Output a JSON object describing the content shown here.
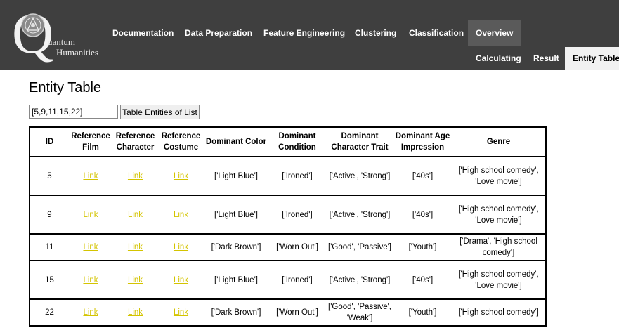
{
  "logo": {
    "letter": "Q",
    "line1": "uantum",
    "line2": "Humanities"
  },
  "nav": {
    "documentation": "Documentation",
    "data_preparation": "Data Preparation",
    "feature_engineering": "Feature Engineering",
    "clustering": "Clustering",
    "classification": "Classification",
    "overview": "Overview"
  },
  "subnav": {
    "calculating": "Calculating",
    "result": "Result",
    "entity_table": "Entity Table"
  },
  "page": {
    "title": "Entity Table",
    "input_value": "[5,9,11,15,22]",
    "button_label": "Table Entities of List"
  },
  "colors": {
    "topbar": "#3f3f3f",
    "link": "#d4c400",
    "active_nav": "#5a5a5a",
    "active_subnav": "#f1f1f1"
  },
  "table": {
    "headers": [
      "ID",
      "Reference Film",
      "Reference Character",
      "Reference Costume",
      "Dominant Color",
      "Dominant Condition",
      "Dominant Character Trait",
      "Dominant Age Impression",
      "Genre"
    ],
    "link_text": "Link",
    "rows": [
      {
        "id": "5",
        "color": "['Light Blue']",
        "condition": "['Ironed']",
        "trait": "['Active', 'Strong']",
        "age": "['40s']",
        "genre": "['High school comedy', 'Love movie']"
      },
      {
        "id": "9",
        "color": "['Light Blue']",
        "condition": "['Ironed']",
        "trait": "['Active', 'Strong']",
        "age": "['40s']",
        "genre": "['High school comedy', 'Love movie']"
      },
      {
        "id": "11",
        "color": "['Dark Brown']",
        "condition": "['Worn Out']",
        "trait": "['Good', 'Passive']",
        "age": "['Youth']",
        "genre": "['Drama', 'High school comedy']"
      },
      {
        "id": "15",
        "color": "['Light Blue']",
        "condition": "['Ironed']",
        "trait": "['Active', 'Strong']",
        "age": "['40s']",
        "genre": "['High school comedy', 'Love movie']"
      },
      {
        "id": "22",
        "color": "['Dark Brown']",
        "condition": "['Worn Out']",
        "trait": "['Good', 'Passive', 'Weak']",
        "age": "['Youth']",
        "genre": "['High school comedy']"
      }
    ]
  }
}
